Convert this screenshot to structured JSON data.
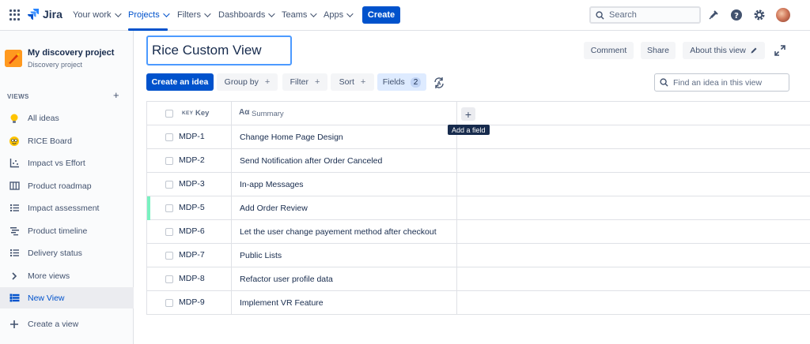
{
  "topnav": {
    "logo_text": "Jira",
    "items": [
      {
        "label": "Your work",
        "active": false
      },
      {
        "label": "Projects",
        "active": true
      },
      {
        "label": "Filters",
        "active": false
      },
      {
        "label": "Dashboards",
        "active": false
      },
      {
        "label": "Teams",
        "active": false
      },
      {
        "label": "Apps",
        "active": false
      }
    ],
    "create_label": "Create",
    "search_placeholder": "Search",
    "accent_color": "#0052cc"
  },
  "sidebar": {
    "project_name": "My discovery project",
    "project_type": "Discovery project",
    "views_label": "VIEWS",
    "views_add": "+",
    "items": [
      {
        "label": "All ideas",
        "icon": "lightbulb-icon"
      },
      {
        "label": "RICE Board",
        "icon": "emoji-icon"
      },
      {
        "label": "Impact vs Effort",
        "icon": "matrix-icon"
      },
      {
        "label": "Product roadmap",
        "icon": "board-icon"
      },
      {
        "label": "Impact assessment",
        "icon": "list-icon"
      },
      {
        "label": "Product timeline",
        "icon": "timeline-icon"
      },
      {
        "label": "Delivery status",
        "icon": "list-icon"
      },
      {
        "label": "More views",
        "icon": "chevron-right-icon"
      },
      {
        "label": "New View",
        "icon": "list-icon",
        "selected": true
      }
    ],
    "create_view_label": "Create a view"
  },
  "main": {
    "view_title": "Rice Custom View",
    "comment_label": "Comment",
    "share_label": "Share",
    "about_label": "About this view",
    "toolbar": {
      "create_idea_label": "Create an idea",
      "group_by_label": "Group by",
      "filter_label": "Filter",
      "sort_label": "Sort",
      "fields_label": "Fields",
      "fields_count": "2",
      "plus": "+"
    },
    "find_placeholder": "Find an idea in this view"
  },
  "table": {
    "key_tag": "KEY",
    "key_header": "Key",
    "summary_icon": "Aα",
    "summary_header": "Summary",
    "add_field_symbol": "+",
    "add_field_tooltip": "Add a field",
    "rows": [
      {
        "key": "MDP-1",
        "summary": "Change Home Page Design"
      },
      {
        "key": "MDP-2",
        "summary": "Send Notification after Order Canceled"
      },
      {
        "key": "MDP-3",
        "summary": "In-app Messages"
      },
      {
        "key": "MDP-5",
        "summary": "Add Order Review",
        "marked": true
      },
      {
        "key": "MDP-6",
        "summary": "Let the user change payement method after checkout"
      },
      {
        "key": "MDP-7",
        "summary": "Public Lists"
      },
      {
        "key": "MDP-8",
        "summary": "Refactor user profile data"
      },
      {
        "key": "MDP-9",
        "summary": "Implement VR Feature"
      }
    ]
  }
}
